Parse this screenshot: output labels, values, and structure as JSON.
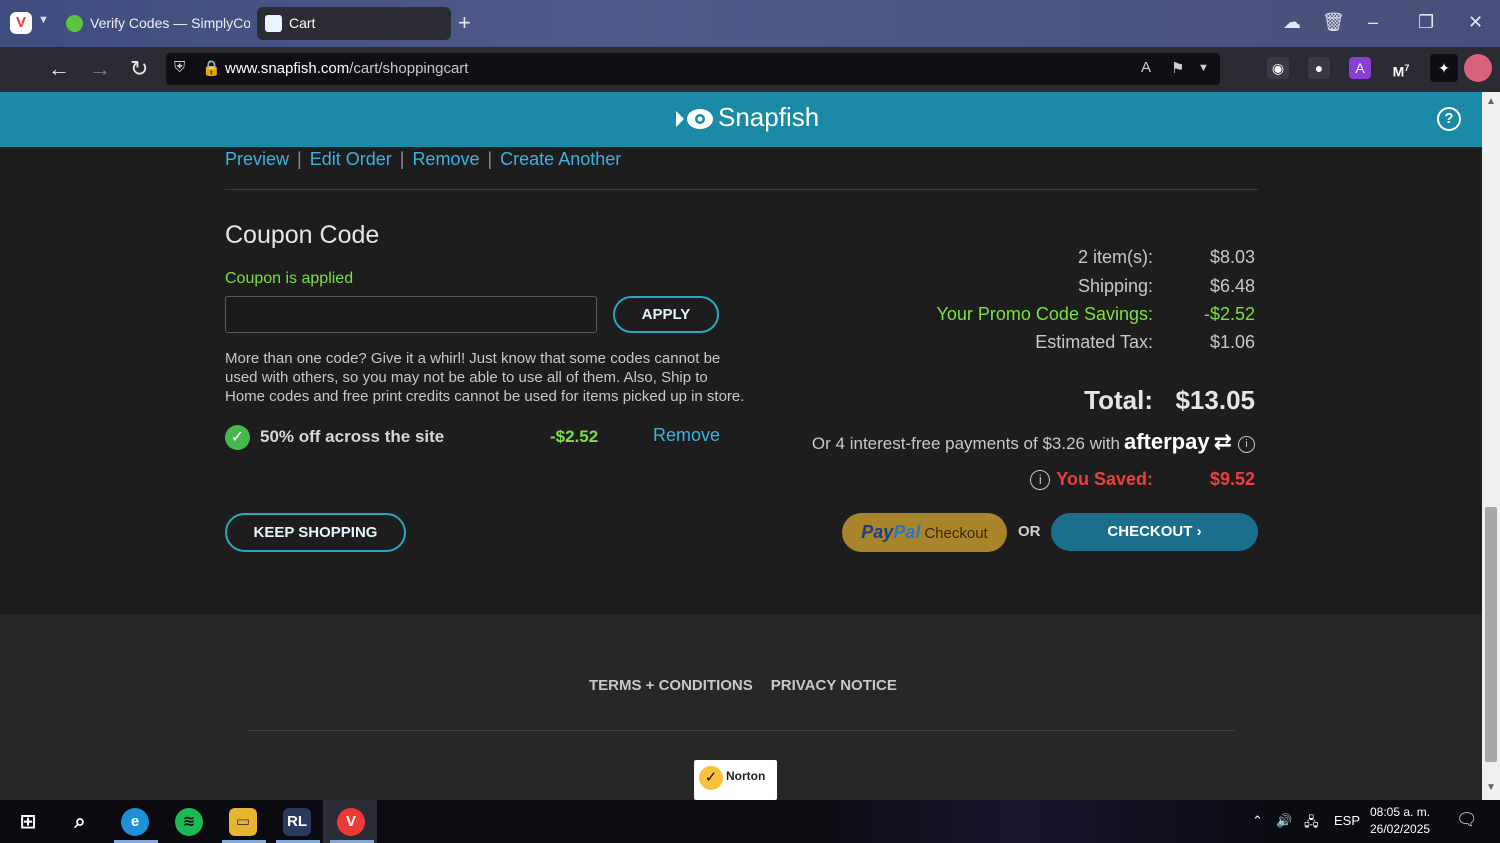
{
  "browser": {
    "tabs": [
      {
        "title": "Verify Codes — SimplyCodes",
        "active": false
      },
      {
        "title": "Cart",
        "active": true
      }
    ],
    "url_domain": "www.snapfish.com",
    "url_path": "/cart/shoppingcart",
    "extension_badge": "7"
  },
  "site": {
    "brand": "Snapfish",
    "help_symbol": "?"
  },
  "item_links": [
    "Preview",
    "Edit Order",
    "Remove",
    "Create Another"
  ],
  "coupon": {
    "title": "Coupon Code",
    "status": "Coupon is applied",
    "input_value": "",
    "apply_label": "APPLY",
    "help_text": "More than one code? Give it a whirl! Just know that some codes cannot be used with others, so you may not be able to use all of them. Also, Ship to Home codes and free print credits cannot be used for items picked up in store.",
    "applied": {
      "name": "50% off across the site",
      "amount": "-$2.52",
      "remove_label": "Remove"
    }
  },
  "summary": {
    "items_label": "2 item(s):",
    "items_value": "$8.03",
    "shipping_label": "Shipping:",
    "shipping_value": "$6.48",
    "promo_label": "Your Promo Code Savings:",
    "promo_value": "-$2.52",
    "tax_label": "Estimated Tax:",
    "tax_value": "$1.06",
    "total_label": "Total:",
    "total_value": "$13.05",
    "afterpay_text": "Or 4 interest-free payments of $3.26 with",
    "afterpay_brand": "afterpay",
    "saved_label": "You Saved:",
    "saved_value": "$9.52"
  },
  "actions": {
    "keep_shopping": "KEEP SHOPPING",
    "paypal_word1": "Pay",
    "paypal_word2": "Pal",
    "paypal_checkout": "Checkout",
    "or": "OR",
    "checkout": "CHECKOUT"
  },
  "footer": {
    "terms": "TERMS + CONDITIONS",
    "privacy": "PRIVACY NOTICE",
    "norton": "Norton"
  },
  "taskbar": {
    "language": "ESP",
    "time": "08:05 a. m.",
    "date": "26/02/2025"
  },
  "colors": {
    "header": "#1a8aa6",
    "link": "#3bb3e0",
    "promo_green": "#7ddf48",
    "saved_red": "#ef3e3e",
    "checkout": "#1c6f8c",
    "paypal": "#a8842a"
  }
}
